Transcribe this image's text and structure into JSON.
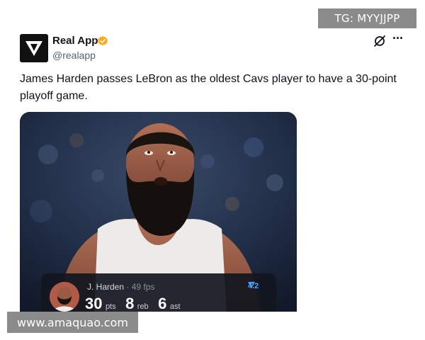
{
  "watermarks": {
    "top_right": "TG: MYYJJPP",
    "bottom_left": "www.amaquao.com"
  },
  "account": {
    "display_name": "Real App",
    "handle": "@realapp",
    "avatar_icon": "real-app-logo-icon",
    "verified_icon": "verified-badge-icon"
  },
  "header_actions": {
    "grok_icon": "grok-icon",
    "more_label": "···"
  },
  "tweet": {
    "text": "James Harden passes LeBron as the oldest Cavs player to have a 30-point playoff game."
  },
  "media": {
    "stat_card": {
      "player": "J. Harden",
      "fps_text": " · 49 fps",
      "rating": "4.2",
      "rating_icon": "real-app-logo-icon",
      "pts": "30",
      "pts_label": "pts",
      "reb": "8",
      "reb_label": "reb",
      "ast": "6",
      "ast_label": "ast"
    }
  },
  "colors": {
    "verified": "#ffad1f",
    "rating_accent": "#4ea2ff"
  }
}
